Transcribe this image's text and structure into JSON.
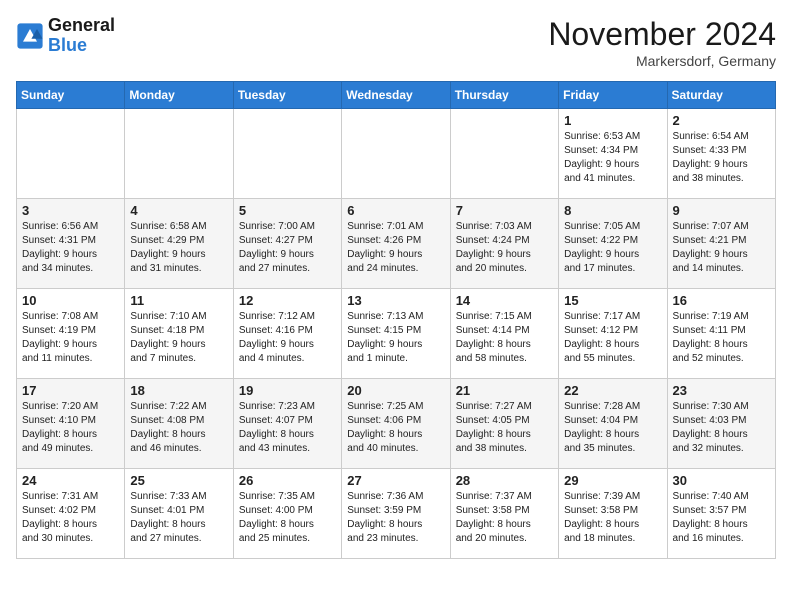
{
  "logo": {
    "line1": "General",
    "line2": "Blue"
  },
  "title": "November 2024",
  "location": "Markersdorf, Germany",
  "weekdays": [
    "Sunday",
    "Monday",
    "Tuesday",
    "Wednesday",
    "Thursday",
    "Friday",
    "Saturday"
  ],
  "weeks": [
    [
      {
        "day": "",
        "info": ""
      },
      {
        "day": "",
        "info": ""
      },
      {
        "day": "",
        "info": ""
      },
      {
        "day": "",
        "info": ""
      },
      {
        "day": "",
        "info": ""
      },
      {
        "day": "1",
        "info": "Sunrise: 6:53 AM\nSunset: 4:34 PM\nDaylight: 9 hours\nand 41 minutes."
      },
      {
        "day": "2",
        "info": "Sunrise: 6:54 AM\nSunset: 4:33 PM\nDaylight: 9 hours\nand 38 minutes."
      }
    ],
    [
      {
        "day": "3",
        "info": "Sunrise: 6:56 AM\nSunset: 4:31 PM\nDaylight: 9 hours\nand 34 minutes."
      },
      {
        "day": "4",
        "info": "Sunrise: 6:58 AM\nSunset: 4:29 PM\nDaylight: 9 hours\nand 31 minutes."
      },
      {
        "day": "5",
        "info": "Sunrise: 7:00 AM\nSunset: 4:27 PM\nDaylight: 9 hours\nand 27 minutes."
      },
      {
        "day": "6",
        "info": "Sunrise: 7:01 AM\nSunset: 4:26 PM\nDaylight: 9 hours\nand 24 minutes."
      },
      {
        "day": "7",
        "info": "Sunrise: 7:03 AM\nSunset: 4:24 PM\nDaylight: 9 hours\nand 20 minutes."
      },
      {
        "day": "8",
        "info": "Sunrise: 7:05 AM\nSunset: 4:22 PM\nDaylight: 9 hours\nand 17 minutes."
      },
      {
        "day": "9",
        "info": "Sunrise: 7:07 AM\nSunset: 4:21 PM\nDaylight: 9 hours\nand 14 minutes."
      }
    ],
    [
      {
        "day": "10",
        "info": "Sunrise: 7:08 AM\nSunset: 4:19 PM\nDaylight: 9 hours\nand 11 minutes."
      },
      {
        "day": "11",
        "info": "Sunrise: 7:10 AM\nSunset: 4:18 PM\nDaylight: 9 hours\nand 7 minutes."
      },
      {
        "day": "12",
        "info": "Sunrise: 7:12 AM\nSunset: 4:16 PM\nDaylight: 9 hours\nand 4 minutes."
      },
      {
        "day": "13",
        "info": "Sunrise: 7:13 AM\nSunset: 4:15 PM\nDaylight: 9 hours\nand 1 minute."
      },
      {
        "day": "14",
        "info": "Sunrise: 7:15 AM\nSunset: 4:14 PM\nDaylight: 8 hours\nand 58 minutes."
      },
      {
        "day": "15",
        "info": "Sunrise: 7:17 AM\nSunset: 4:12 PM\nDaylight: 8 hours\nand 55 minutes."
      },
      {
        "day": "16",
        "info": "Sunrise: 7:19 AM\nSunset: 4:11 PM\nDaylight: 8 hours\nand 52 minutes."
      }
    ],
    [
      {
        "day": "17",
        "info": "Sunrise: 7:20 AM\nSunset: 4:10 PM\nDaylight: 8 hours\nand 49 minutes."
      },
      {
        "day": "18",
        "info": "Sunrise: 7:22 AM\nSunset: 4:08 PM\nDaylight: 8 hours\nand 46 minutes."
      },
      {
        "day": "19",
        "info": "Sunrise: 7:23 AM\nSunset: 4:07 PM\nDaylight: 8 hours\nand 43 minutes."
      },
      {
        "day": "20",
        "info": "Sunrise: 7:25 AM\nSunset: 4:06 PM\nDaylight: 8 hours\nand 40 minutes."
      },
      {
        "day": "21",
        "info": "Sunrise: 7:27 AM\nSunset: 4:05 PM\nDaylight: 8 hours\nand 38 minutes."
      },
      {
        "day": "22",
        "info": "Sunrise: 7:28 AM\nSunset: 4:04 PM\nDaylight: 8 hours\nand 35 minutes."
      },
      {
        "day": "23",
        "info": "Sunrise: 7:30 AM\nSunset: 4:03 PM\nDaylight: 8 hours\nand 32 minutes."
      }
    ],
    [
      {
        "day": "24",
        "info": "Sunrise: 7:31 AM\nSunset: 4:02 PM\nDaylight: 8 hours\nand 30 minutes."
      },
      {
        "day": "25",
        "info": "Sunrise: 7:33 AM\nSunset: 4:01 PM\nDaylight: 8 hours\nand 27 minutes."
      },
      {
        "day": "26",
        "info": "Sunrise: 7:35 AM\nSunset: 4:00 PM\nDaylight: 8 hours\nand 25 minutes."
      },
      {
        "day": "27",
        "info": "Sunrise: 7:36 AM\nSunset: 3:59 PM\nDaylight: 8 hours\nand 23 minutes."
      },
      {
        "day": "28",
        "info": "Sunrise: 7:37 AM\nSunset: 3:58 PM\nDaylight: 8 hours\nand 20 minutes."
      },
      {
        "day": "29",
        "info": "Sunrise: 7:39 AM\nSunset: 3:58 PM\nDaylight: 8 hours\nand 18 minutes."
      },
      {
        "day": "30",
        "info": "Sunrise: 7:40 AM\nSunset: 3:57 PM\nDaylight: 8 hours\nand 16 minutes."
      }
    ]
  ]
}
